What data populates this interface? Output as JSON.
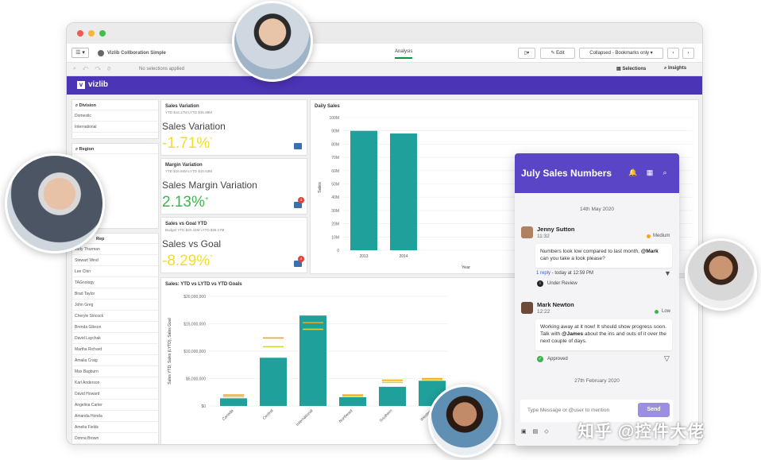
{
  "window": {
    "app_title": "Vizlib Collboration Simple",
    "tab": "Analysis",
    "edit_label": "Edit",
    "bookmarks_label": "Collapsed - Bookmarks only",
    "no_selections": "No selections applied",
    "selections_label": "Selections",
    "insights_label": "Insights",
    "brand": "vizlib"
  },
  "filters": {
    "division": {
      "title": "Division",
      "items": [
        "Domestic",
        "International"
      ]
    },
    "region": {
      "title": "Region"
    },
    "rep": {
      "title": "Rep",
      "items": [
        "Judy Thurman",
        "Stewart Wind",
        "Lee Chin",
        "TAGnology",
        "Brad Taylor",
        "John Greg",
        "Cheryle Sincock",
        "Brenda Gibson",
        "David Laychak",
        "Martha Richard",
        "Amalia Craig",
        "Max Bagburn",
        "Karl Anderson",
        "David Howard",
        "Angelina Carter",
        "Amanda Honda",
        "Amelia Fields",
        "Donna Brown"
      ]
    }
  },
  "kpis": [
    {
      "title": "Sales Variation",
      "sub": "YTD $16.17M LYTD $36.88M",
      "label": "Sales Variation",
      "value": "-1.71%",
      "arrow": "*",
      "color": "#f2dd2e",
      "badge": ""
    },
    {
      "title": "Margin Variation",
      "sub": "YTD $16.66M LYTD $15.53M",
      "label": "Sales Margin Variation",
      "value": "2.13%",
      "arrow": "+",
      "color": "#3fb34f",
      "badge": "3"
    },
    {
      "title": "Sales vs Goal YTD",
      "sub": "Budget YTD $20.44M LYTD $36.17M",
      "label": "Sales vs Goal",
      "value": "-8.29%",
      "arrow": "*",
      "color": "#f2dd2e",
      "badge": "4"
    }
  ],
  "chart_data": [
    {
      "type": "bar",
      "title": "Daily Sales",
      "categories": [
        "2013",
        "2014"
      ],
      "values": [
        90,
        88
      ],
      "unit_suffix": "M",
      "ylabel": "Sales",
      "xlabel": "Year",
      "ylim": [
        0,
        100
      ],
      "yticks": [
        "0",
        "10M",
        "20M",
        "30M",
        "40M",
        "50M",
        "60M",
        "70M",
        "80M",
        "90M",
        "100M"
      ],
      "color": "#1fa09b"
    },
    {
      "type": "bar",
      "title": "Sales: YTD vs LYTD vs YTD Goals",
      "categories": [
        "Canada",
        "Central",
        "International",
        "Northeast",
        "Southern",
        "Western"
      ],
      "ylabel": "Sales YTD, Sales (LYTD), Sales Goal",
      "ylim": [
        0,
        20000000
      ],
      "yticks": [
        "$0",
        "$5,000,000",
        "$10,000,000",
        "$15,000,000",
        "$20,000,000"
      ],
      "series": [
        {
          "name": "Sales YTD",
          "values": [
            1400000,
            8800000,
            16500000,
            1600000,
            3500000,
            4600000
          ],
          "color": "#1fa09b"
        },
        {
          "name": "Sales (LYTD)",
          "values": [
            2000000,
            12400000,
            15200000,
            2000000,
            4700000,
            5000000
          ],
          "color": "#f2a81d"
        },
        {
          "name": "Sales Goal",
          "values": [
            1700000,
            10800000,
            14000000,
            1800000,
            4300000,
            4800000
          ],
          "color": "#d6d23a"
        }
      ]
    }
  ],
  "chat": {
    "title": "July Sales Numbers",
    "dates": [
      "14th May 2020",
      "27th February 2020"
    ],
    "messages": [
      {
        "name": "Jenny Sutton",
        "time": "11:32",
        "priority": "Medium",
        "priority_color": "#f5a623",
        "text_pre": "Numbers look low compared to last month,",
        "mention": "@Mark",
        "text_post": " can you take a look please?",
        "reply_link": "1 reply",
        "reply_meta": " - today at 12:59 PM",
        "status": "Under Review",
        "status_color": "#222"
      },
      {
        "name": "Mark Newton",
        "time": "12:22",
        "priority": "Low",
        "priority_color": "#3fb34f",
        "text_pre": "Working away at it now! It should show progress soon. Talk with ",
        "mention": "@James",
        "text_post": " about the ins and outs of it over the next couple of days.",
        "status": "Approved",
        "status_color": "#3fb34f"
      }
    ],
    "input_placeholder": "Type Message or @user to mention",
    "send_label": "Send"
  },
  "watermark": "知乎 @控件大佬"
}
